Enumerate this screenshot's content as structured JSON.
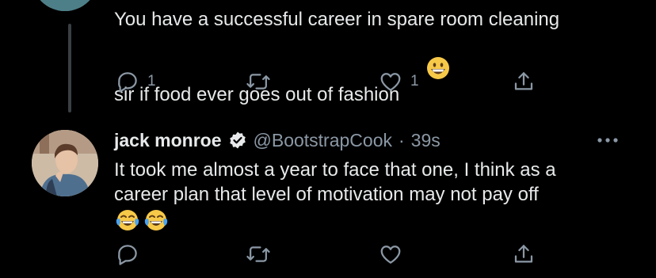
{
  "tweet1": {
    "text": "You have a successful career in spare room cleaning\nsir if food ever goes out of fashion",
    "emoji": "grinning-face",
    "reply_count": "1",
    "like_count": "1"
  },
  "tweet2": {
    "display_name": "jack monroe",
    "verified": true,
    "handle": "@BootstrapCook",
    "separator": "·",
    "time": "39s",
    "text": "It took me almost a year to face that one, I think as a\ncareer plan that level of motivation may not pay off",
    "emojis": [
      "face-with-tears-of-joy",
      "face-with-tears-of-joy"
    ]
  },
  "colors": {
    "background": "#000000",
    "text": "#e7e9ea",
    "muted": "#8b98a5",
    "thread_line": "#3a3f44",
    "emoji_yellow": "#f7c948"
  }
}
